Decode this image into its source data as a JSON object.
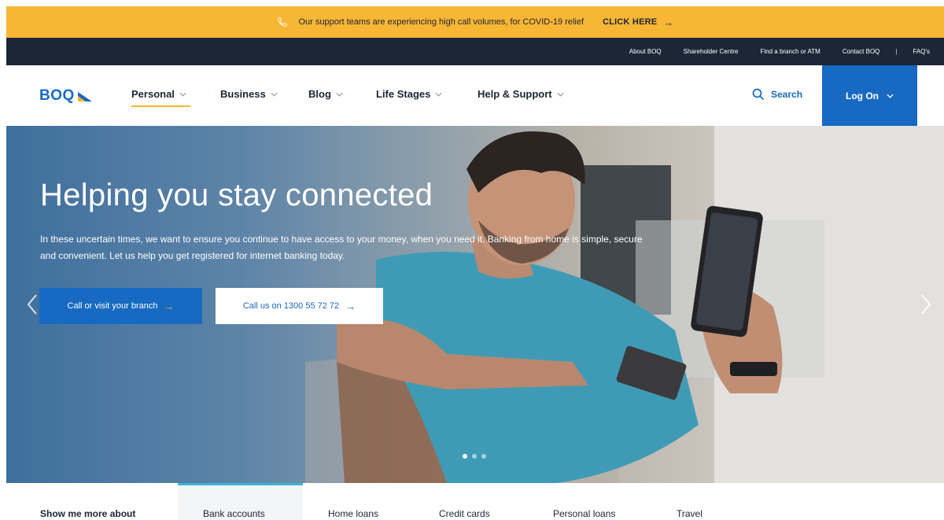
{
  "alert": {
    "message": "Our support teams are experiencing high call volumes, for COVID-19 relief",
    "cta_label": "CLICK HERE",
    "arrow": "→"
  },
  "utility_nav": {
    "links": [
      "About BOQ",
      "Shareholder Centre",
      "Find a branch or ATM",
      "Contact BOQ",
      "FAQ's"
    ],
    "separator": "|"
  },
  "main_nav": {
    "logo_text": "BOQ",
    "items": [
      {
        "label": "Personal",
        "active": true
      },
      {
        "label": "Business",
        "active": false
      },
      {
        "label": "Blog",
        "active": false
      },
      {
        "label": "Life Stages",
        "active": false
      },
      {
        "label": "Help & Support",
        "active": false
      }
    ],
    "search_label": "Search",
    "logon_label": "Log On"
  },
  "hero": {
    "title": "Helping you stay connected",
    "body": "In these uncertain times, we want to ensure you continue to have access to your money, when you need it. Banking from home is simple, secure and convenient. Let us help you get registered for internet banking today.",
    "primary_button": "Call or visit your branch",
    "secondary_button": "Call us on 1300 55 72 72",
    "arrow": "→",
    "slide_count": 3,
    "active_slide": 1
  },
  "tabs": {
    "lead": "Show me more about",
    "items": [
      "Bank accounts",
      "Home loans",
      "Credit cards",
      "Personal loans",
      "Travel"
    ],
    "active_index": 0
  },
  "colors": {
    "brand_blue": "#1769c1",
    "alert_yellow": "#f7b634",
    "dark_navy": "#1c2637",
    "tab_accent": "#39b5d3"
  }
}
